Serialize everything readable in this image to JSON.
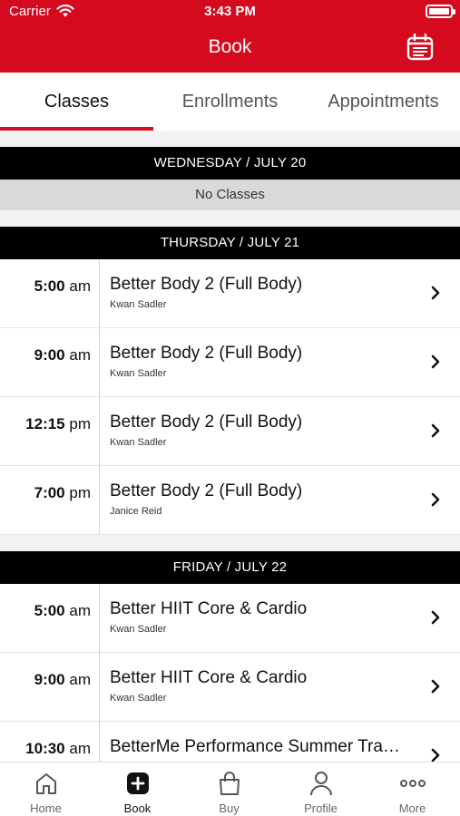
{
  "status_bar": {
    "carrier": "Carrier",
    "time": "3:43 PM"
  },
  "header": {
    "title": "Book",
    "calendar_icon": "calendar-icon"
  },
  "tabs": [
    {
      "label": "Classes",
      "active": true
    },
    {
      "label": "Enrollments",
      "active": false
    },
    {
      "label": "Appointments",
      "active": false
    }
  ],
  "days": [
    {
      "header": "WEDNESDAY / JULY 20",
      "empty_label": "No Classes",
      "classes": []
    },
    {
      "header": "THURSDAY / JULY 21",
      "classes": [
        {
          "time": "5:00",
          "ampm": "am",
          "name": "Better Body 2 (Full Body)",
          "instructor": "Kwan Sadler"
        },
        {
          "time": "9:00",
          "ampm": "am",
          "name": "Better Body 2 (Full Body)",
          "instructor": "Kwan Sadler"
        },
        {
          "time": "12:15",
          "ampm": "pm",
          "name": "Better Body 2 (Full Body)",
          "instructor": "Kwan Sadler"
        },
        {
          "time": "7:00",
          "ampm": "pm",
          "name": "Better Body 2 (Full Body)",
          "instructor": "Janice Reid"
        }
      ]
    },
    {
      "header": "FRIDAY / JULY 22",
      "classes": [
        {
          "time": "5:00",
          "ampm": "am",
          "name": "Better HIIT Core & Cardio",
          "instructor": "Kwan Sadler"
        },
        {
          "time": "9:00",
          "ampm": "am",
          "name": "Better HIIT Core & Cardio",
          "instructor": "Kwan Sadler"
        },
        {
          "time": "10:30",
          "ampm": "am",
          "name": "BetterMe Performance Summer Tra…",
          "instructor": ""
        }
      ]
    }
  ],
  "tabbar": [
    {
      "label": "Home",
      "icon": "home-icon",
      "active": false
    },
    {
      "label": "Book",
      "icon": "plus-square-icon",
      "active": true
    },
    {
      "label": "Buy",
      "icon": "shopping-bag-icon",
      "active": false
    },
    {
      "label": "Profile",
      "icon": "person-icon",
      "active": false
    },
    {
      "label": "More",
      "icon": "more-dots-icon",
      "active": false
    }
  ],
  "colors": {
    "brand_red": "#d50a1e",
    "day_header_bg": "#000000",
    "no_classes_bg": "#d9d9d9"
  }
}
